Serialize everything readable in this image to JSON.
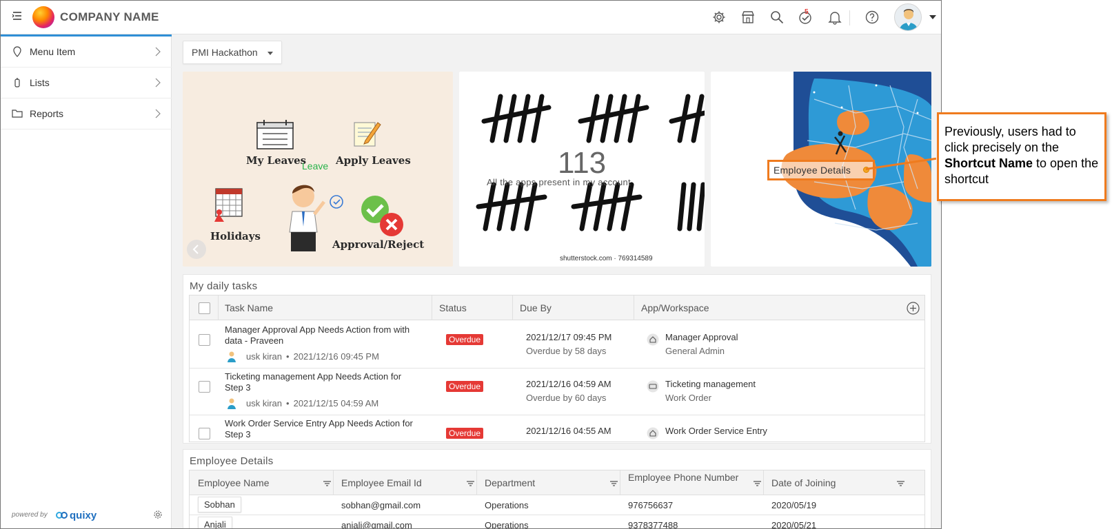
{
  "topbar": {
    "company_name": "COMPANY NAME",
    "notification_count": "5",
    "icons": [
      "menu-icon",
      "gear-icon",
      "store-icon",
      "search-icon",
      "tasks-check-icon",
      "bell-icon",
      "help-icon",
      "avatar",
      "chevron-down-icon"
    ]
  },
  "sidebar": {
    "items": [
      {
        "label": "Menu Item",
        "icon": "location-pin-icon"
      },
      {
        "label": "Lists",
        "icon": "list-icon"
      },
      {
        "label": "Reports",
        "icon": "folder-icon"
      }
    ],
    "powered_by": "powered by",
    "brand": "quixy"
  },
  "workspace": {
    "selected": "PMI Hackathon"
  },
  "cards": {
    "leave": {
      "my_leaves": "My Leaves",
      "leave": "Leave",
      "apply_leaves": "Apply Leaves",
      "holidays": "Holidays",
      "approval": "Approval/Reject"
    },
    "apps": {
      "count": "113",
      "subtitle": "All the apps present in my account",
      "watermark": "shutterstock.com · 769314589"
    },
    "shortcut": {
      "label": "Employee Details"
    }
  },
  "daily_tasks": {
    "title": "My daily tasks",
    "columns": [
      "Task Name",
      "Status",
      "Due By",
      "App/Workspace"
    ],
    "rows": [
      {
        "name": "Manager Approval App Needs Action from with data - Praveen",
        "user": "usk kiran",
        "created": "2021/12/16 09:45 PM",
        "status": "Overdue",
        "due": "2021/12/17 09:45 PM",
        "overdue_by": "Overdue by 58 days",
        "app": "Manager Approval",
        "workspace": "General Admin"
      },
      {
        "name": "Ticketing management App Needs Action for Step 3",
        "user": "usk kiran",
        "created": "2021/12/15 04:59 AM",
        "status": "Overdue",
        "due": "2021/12/16 04:59 AM",
        "overdue_by": "Overdue by 60 days",
        "app": "Ticketing management",
        "workspace": "Work Order"
      },
      {
        "name": "Work Order Service Entry App Needs Action for Step 3",
        "user": "",
        "created": "",
        "status": "Overdue",
        "due": "2021/12/16 04:55 AM",
        "overdue_by": "",
        "app": "Work Order Service Entry",
        "workspace": ""
      }
    ]
  },
  "employee_details": {
    "title": "Employee Details",
    "columns": [
      "Employee Name",
      "Employee Email Id",
      "Department",
      "Employee Phone Number",
      "Date of Joining"
    ],
    "rows": [
      {
        "name": "Sobhan",
        "email": "sobhan@gmail.com",
        "department": "Operations",
        "phone": "976756637",
        "doj": "2020/05/19"
      },
      {
        "name": "Anjali",
        "email": "anjali@gmail.com",
        "department": "Operations",
        "phone": "9378377488",
        "doj": "2020/05/21"
      }
    ]
  },
  "callout": {
    "text_before": "Previously, users had to click precisely on the ",
    "bold": "Shortcut Name",
    "text_after": " to open the shortcut"
  },
  "colors": {
    "accent": "#2f8fd6",
    "overdue": "#e53935",
    "callout_border": "#ef7b1e"
  }
}
